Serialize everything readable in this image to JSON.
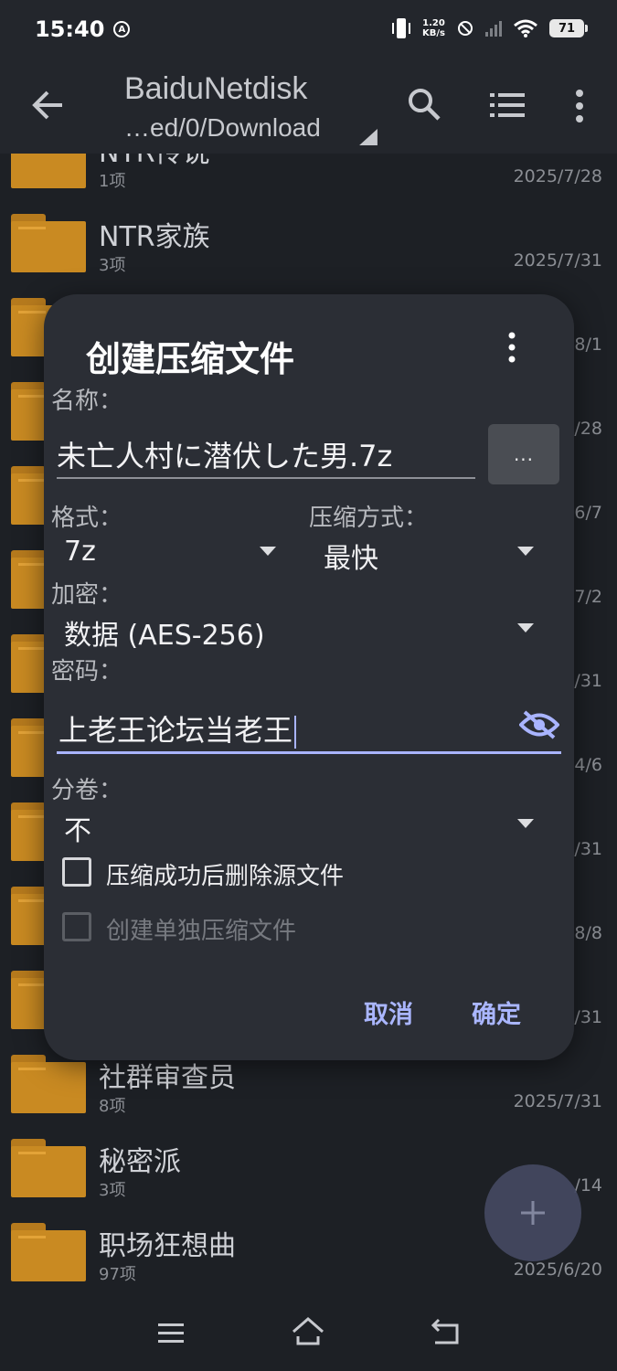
{
  "status_bar": {
    "time": "15:40",
    "badge": "A",
    "net_speed_value": "1.20",
    "net_speed_unit": "KB/s",
    "battery": "71"
  },
  "toolbar": {
    "title": "BaiduNetdisk",
    "path": "…ed/0/Download"
  },
  "files": [
    {
      "name": "NTR传说",
      "meta": "1项",
      "date": "2025/7/28"
    },
    {
      "name": "NTR家族",
      "meta": "3项",
      "date": "2025/7/31"
    },
    {
      "name": "",
      "meta": "",
      "date": "8/1"
    },
    {
      "name": "",
      "meta": "",
      "date": "/28"
    },
    {
      "name": "",
      "meta": "",
      "date": "6/7"
    },
    {
      "name": "",
      "meta": "",
      "date": "7/2"
    },
    {
      "name": "",
      "meta": "",
      "date": "/31"
    },
    {
      "name": "",
      "meta": "",
      "date": "4/6"
    },
    {
      "name": "",
      "meta": "",
      "date": "/31"
    },
    {
      "name": "",
      "meta": "",
      "date": "8/8"
    },
    {
      "name": "",
      "meta": "",
      "date": "/31"
    },
    {
      "name": "社群审查员",
      "meta": "8项",
      "date": "2025/7/31"
    },
    {
      "name": "秘密派",
      "meta": "3项",
      "date": "/14"
    },
    {
      "name": "职场狂想曲",
      "meta": "97项",
      "date": "2025/6/20"
    }
  ],
  "dialog": {
    "title": "创建压缩文件",
    "name_label": "名称：",
    "name_value": "未亡人村に潜伏した男.7z",
    "browse_label": "...",
    "format_label": "格式：",
    "format_value": "7z",
    "method_label": "压缩方式：",
    "method_value": "最快",
    "encrypt_label": "加密：",
    "encrypt_value": "数据 (AES-256)",
    "password_label": "密码：",
    "password_value": "上老王论坛当老王",
    "split_label": "分卷：",
    "split_value": "不",
    "delete_source_label": "压缩成功后删除源文件",
    "separate_label": "创建单独压缩文件",
    "cancel_label": "取消",
    "ok_label": "确定"
  },
  "colors": {
    "background": "#1d2025",
    "dialog": "#2b2e35",
    "accent": "#aab6ff",
    "folder": "#c98a22"
  }
}
